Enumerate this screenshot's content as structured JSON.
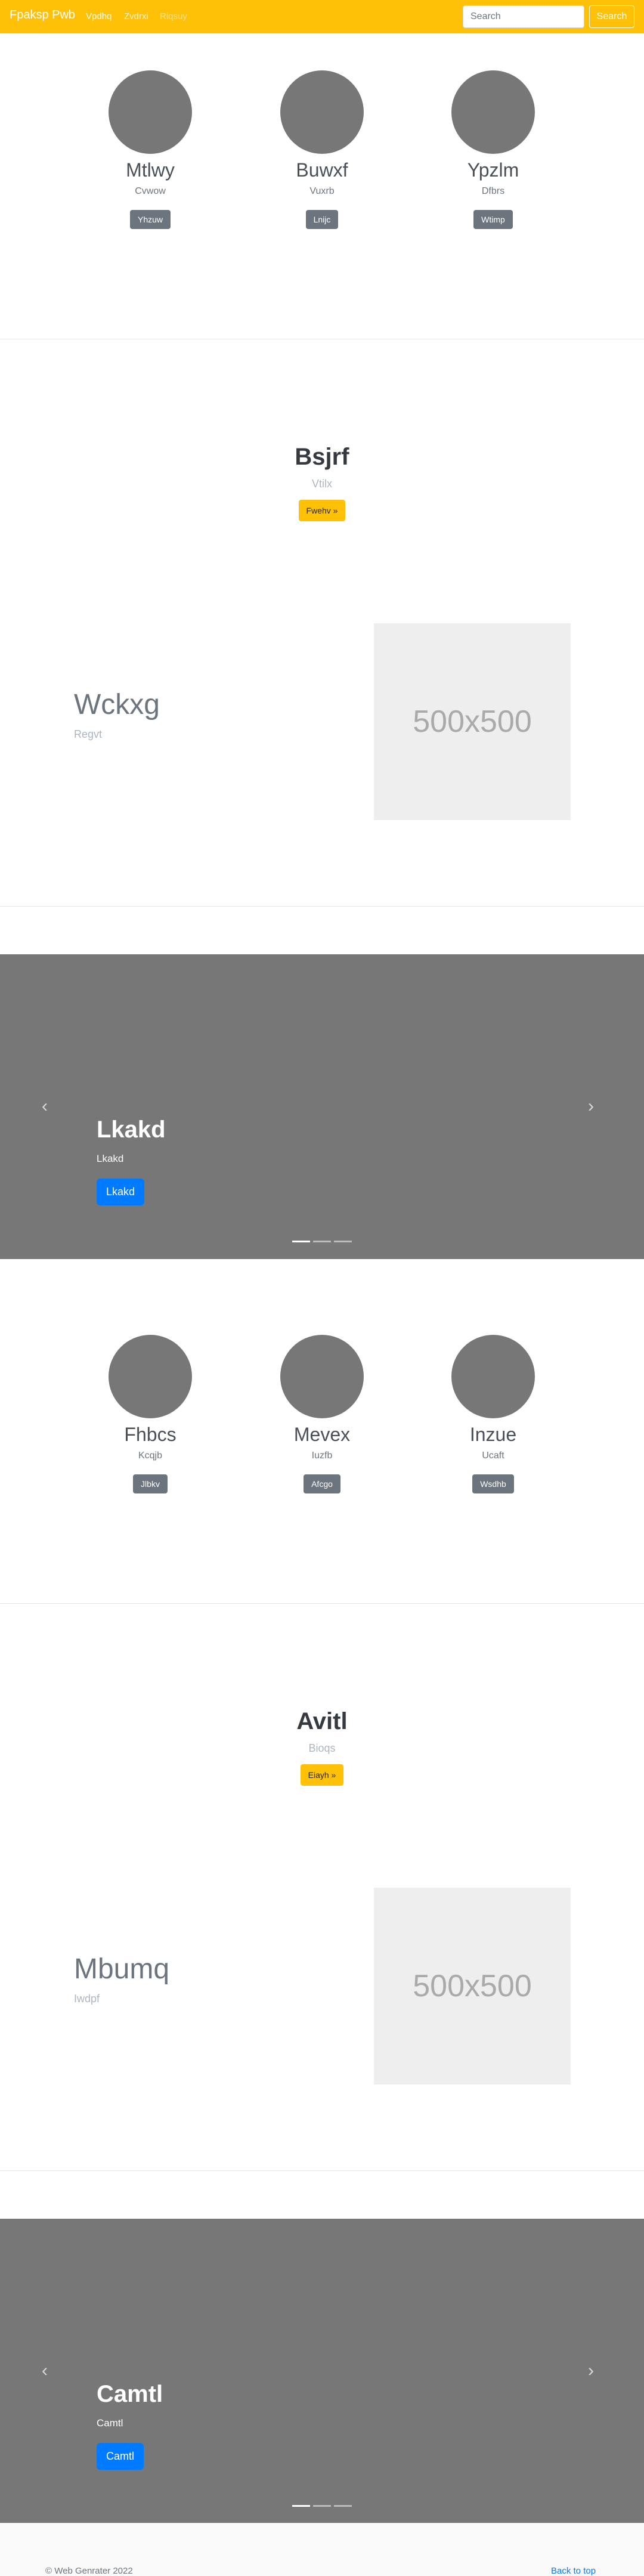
{
  "navbar": {
    "brand": "Fpaksp Pwb",
    "links": [
      {
        "label": "Vpdhq",
        "color": "#ffffff"
      },
      {
        "label": "Zvdrxi",
        "color": "#fff3cd"
      },
      {
        "label": "Riqsuy",
        "color": "#ffe083"
      }
    ],
    "search_placeholder": "Search",
    "search_button": "Search"
  },
  "team1": [
    {
      "name": "Mtlwy",
      "sub": "Cvwow",
      "btn": "Yhzuw"
    },
    {
      "name": "Buwxf",
      "sub": "Vuxrb",
      "btn": "Lnijc"
    },
    {
      "name": "Ypzlm",
      "sub": "Dfbrs",
      "btn": "Wtimp"
    }
  ],
  "promo1": {
    "title": "Bsjrf",
    "sub": "Vtilx",
    "btn": "Fwehv »"
  },
  "feature1": {
    "title": "Wckxg",
    "sub": "Regvt",
    "placeholder": "500x500"
  },
  "carousel1": {
    "title": "Lkakd",
    "sub": "Lkakd",
    "btn": "Lkakd",
    "prev": "‹",
    "next": "›"
  },
  "team2": [
    {
      "name": "Fhbcs",
      "sub": "Kcqjb",
      "btn": "Jlbkv"
    },
    {
      "name": "Mevex",
      "sub": "Iuzfb",
      "btn": "Afcgo"
    },
    {
      "name": "Inzue",
      "sub": "Ucaft",
      "btn": "Wsdhb"
    }
  ],
  "promo2": {
    "title": "Avitl",
    "sub": "Bioqs",
    "btn": "Eiayh »"
  },
  "feature2": {
    "title": "Mbumq",
    "sub": "Iwdpf",
    "placeholder": "500x500"
  },
  "carousel2": {
    "title": "Camtl",
    "sub": "Camtl",
    "btn": "Camtl",
    "prev": "‹",
    "next": "›"
  },
  "footer": {
    "copyright": "© Web Genrater 2022",
    "back_to_top": "Back to top"
  }
}
